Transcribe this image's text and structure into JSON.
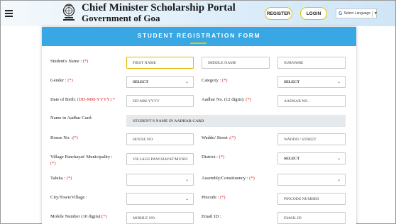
{
  "header": {
    "title": "Chief Minister Scholarship Portal",
    "subtitle": "Government of Goa",
    "register_label": "REGISTER",
    "login_label": "LOGIN",
    "language_label": "Select Language"
  },
  "form": {
    "heading": "STUDENT REGISTRATION FORM",
    "labels": {
      "student_name": "Student's Name :",
      "gender": "Gender :",
      "category": "Category :",
      "dob": "Date of Birth:",
      "dob_format": "(DD-MM-YYYY) *",
      "aadhar_no": "Aadhar No. (12 digits):",
      "name_in_aadhar": "Name in Aadhar Card:",
      "house_no": "House No. :",
      "waddo_street": "Waddo/ Street :",
      "village": "Village Panchayat/ Municipality :",
      "district": "District :",
      "taluka": "Taluka :",
      "assembly": "Assembly/Constituency :",
      "city": "City/Town/Village :",
      "pincode": "Pincode :",
      "mobile": "Mobile Number (10 digits):",
      "email": "Email ID :"
    },
    "required_marker": "(*)",
    "placeholders": {
      "first_name": "FIRST NAME",
      "middle_name": "MIDDLE NAME",
      "surname": "SURNAME",
      "dob": "DD-MM-YYYY",
      "aadhar_no": "AADHAR NO.",
      "name_in_aadhar": "STUDENT'S NAME IN AADHAR CARD",
      "house_no": "HOUSE NO.",
      "waddo_street": "WADDO / STREET",
      "village": "VILLAGE PANCHAYAT/MUNIC",
      "pincode": "PINCODE NUMBER",
      "mobile": "MOBILE NO.",
      "email": "EMAIL ID"
    },
    "selects": {
      "gender": "SELECT",
      "category": "SELECT",
      "district": "SELECT",
      "taluka": "",
      "assembly": "",
      "city": ""
    }
  },
  "colors": {
    "card_header": "#38a7e4",
    "accent": "#f2c200",
    "required": "#e02020"
  }
}
